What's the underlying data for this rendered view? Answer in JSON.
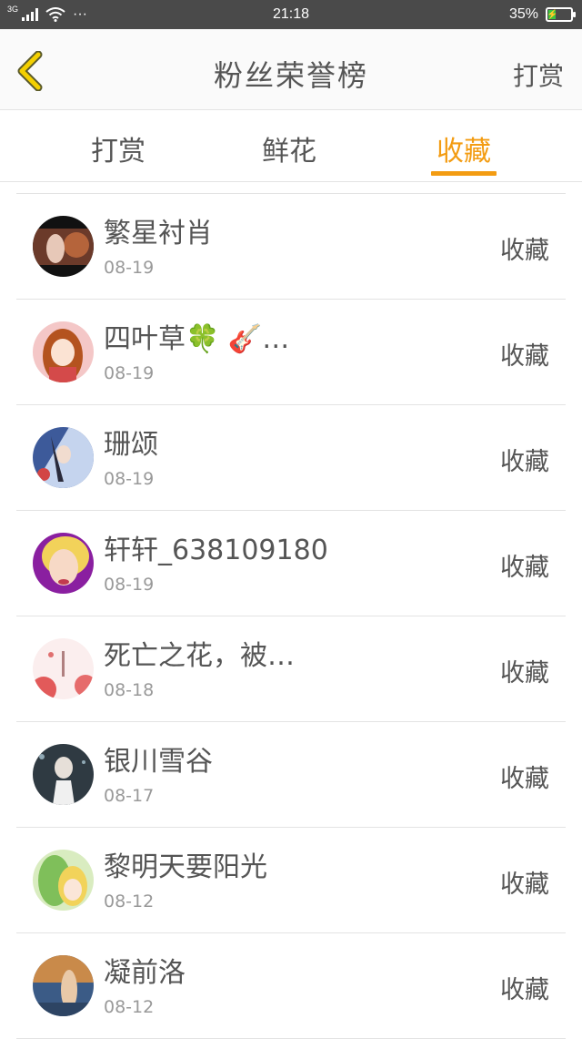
{
  "status_bar": {
    "network": "3G",
    "dots": "···",
    "time": "21:18",
    "battery": "35%",
    "battery_level": 0.35
  },
  "nav": {
    "title": "粉丝荣誉榜",
    "action": "打赏"
  },
  "tabs": [
    {
      "label": "打赏",
      "active": false
    },
    {
      "label": "鲜花",
      "active": false
    },
    {
      "label": "收藏",
      "active": true
    }
  ],
  "colors": {
    "accent": "#f39c12",
    "status_bar_bg": "#4a4a4a",
    "battery_green": "#3ac441"
  },
  "list": [
    {
      "name": "繁星衬肖",
      "date": "08-19",
      "type": "收藏"
    },
    {
      "name": "四叶草🍀 🎸…",
      "date": "08-19",
      "type": "收藏"
    },
    {
      "name": "珊颂",
      "date": "08-19",
      "type": "收藏"
    },
    {
      "name": "轩轩_638109180",
      "date": "08-19",
      "type": "收藏"
    },
    {
      "name": "死亡之花，被…",
      "date": "08-18",
      "type": "收藏"
    },
    {
      "name": "银川雪谷",
      "date": "08-17",
      "type": "收藏"
    },
    {
      "name": "黎明天要阳光",
      "date": "08-12",
      "type": "收藏"
    },
    {
      "name": "凝前洛",
      "date": "08-12",
      "type": "收藏"
    }
  ]
}
